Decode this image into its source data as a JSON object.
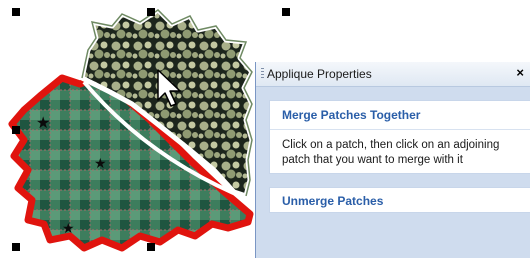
{
  "panel": {
    "title": "Applique Properties",
    "close_glyph": "×",
    "sections": [
      {
        "title": "Merge Patches Together",
        "body": "Click on a patch, then click on an adjoining patch that you want to merge with it"
      },
      {
        "title": "Unmerge Patches"
      }
    ]
  },
  "icons": {
    "cursor": "arrow-cursor-icon",
    "close": "close-icon",
    "grip": "drag-grip-icon"
  },
  "colors": {
    "outline_red": "#e0140e",
    "plaid_green": "#2e6a4e",
    "dark_patch": "#1e2a1f",
    "link_blue": "#2a5ea8"
  }
}
